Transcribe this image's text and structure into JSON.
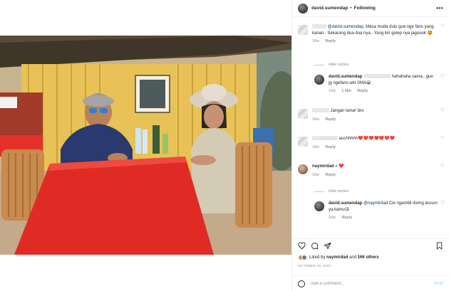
{
  "post": {
    "author": "david.sumendap",
    "follow_status": "Following",
    "more_label": "•••"
  },
  "comments": [
    {
      "user_hidden": true,
      "text_a": "@david.sumendap",
      "text_b": ". Masa muda dulu gue nge fans yang kanan.. Sekarang dua dua nya.. Yang kiri golep nya jagoook 🤩",
      "time": "18w",
      "reply": "Reply"
    },
    {
      "view_replies": "Hide replies"
    },
    {
      "user": "david.sumendap",
      "text": "hahahaha sama.. gue jg ngefans wkt SMA😁",
      "time": "18w",
      "likes": "1 like",
      "reply": "Reply"
    },
    {
      "user_hidden": true,
      "text": "Jangan lama² bro",
      "time": "18w",
      "reply": "Reply"
    },
    {
      "user_hidden": true,
      "text": "auchhhhh",
      "hearts": "❤️❤️❤️❤️❤️❤️❤️",
      "time": "18w",
      "reply": "Reply"
    },
    {
      "user": "naymirdad",
      "text": "❤️",
      "time": "18w",
      "reply": "Reply"
    },
    {
      "view_replies": "Hide replies"
    },
    {
      "user": "david.sumendap",
      "mention": "@naymirdad",
      "text": " Cie ngambil diving lesson ya kamu😘",
      "time": "18w",
      "reply": "Reply"
    }
  ],
  "likes": {
    "prefix": "Liked by ",
    "user": "naymirdad",
    "middle": " and ",
    "others": "166 others"
  },
  "date": "OCTOBER 16, 2021",
  "add_comment": {
    "placeholder": "Add a comment...",
    "post_label": "Post"
  }
}
